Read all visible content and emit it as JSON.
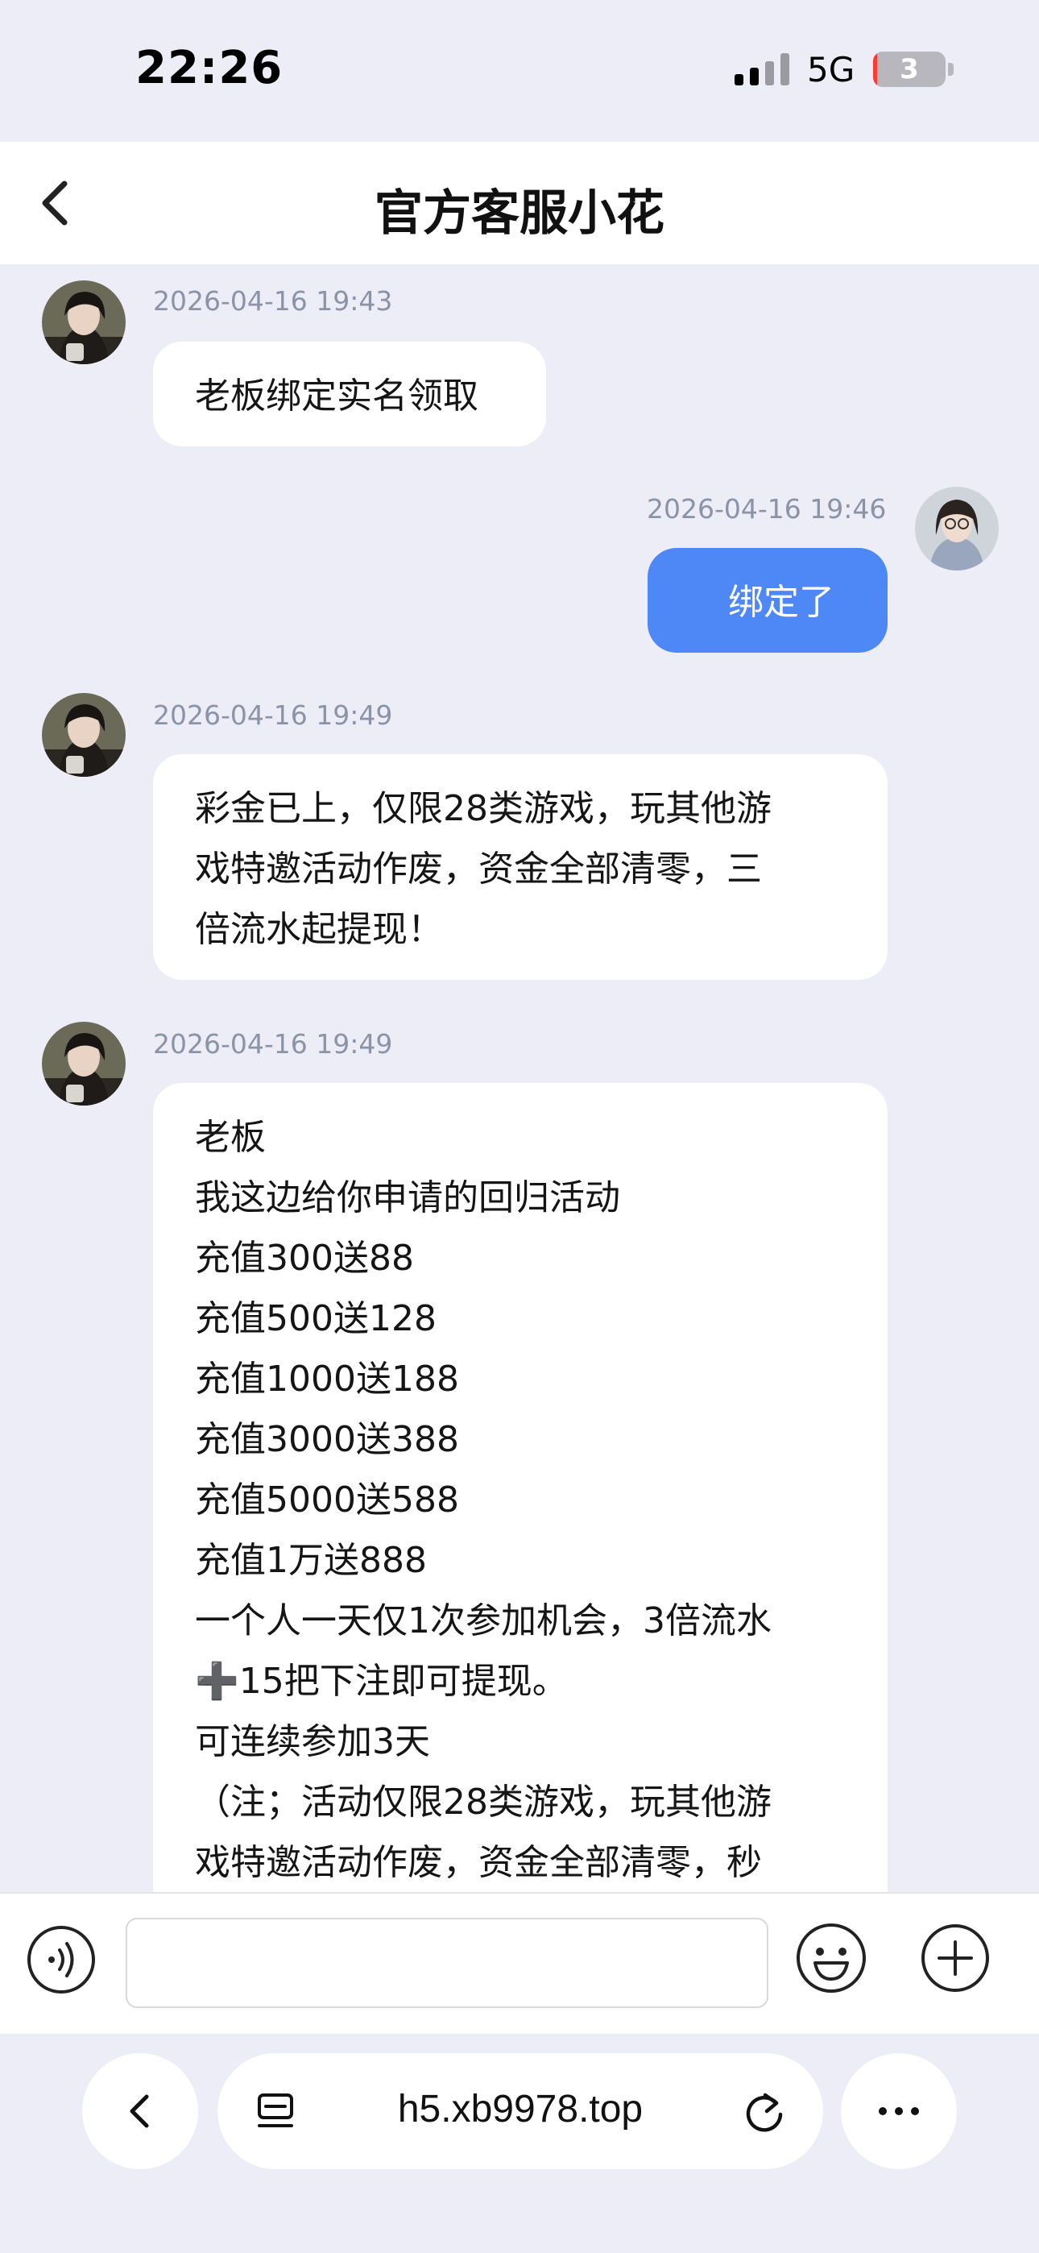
{
  "status_bar": {
    "time": "22:26",
    "network": "5G",
    "battery": "3",
    "battery_level": 0.03
  },
  "header": {
    "title": "官方客服小花",
    "back_icon": "chevron-left-icon"
  },
  "messages": [
    {
      "sender": "agent",
      "timestamp": "2026-04-16 19:43",
      "lines": [
        "老板绑定实名领取"
      ]
    },
    {
      "sender": "user",
      "timestamp": "2026-04-16 19:46",
      "lines": [
        "绑定了"
      ]
    },
    {
      "sender": "agent",
      "timestamp": "2026-04-16 19:49",
      "lines": [
        "彩金已上，仅限28类游戏，玩其他游",
        "戏特邀活动作废，资金全部清零，三",
        "倍流水起提现！"
      ]
    },
    {
      "sender": "agent",
      "timestamp": "2026-04-16 19:49",
      "lines": [
        "老板",
        "我这边给你申请的回归活动",
        "充值300送88",
        "充值500送128",
        "充值1000送188",
        "充值3000送388",
        "充值5000送588",
        "充值1万送888",
        "一个人一天仅1次参加机会，3倍流水",
        "➕15把下注即可提现。",
        "可连续参加3天",
        "（注；活动仅限28类游戏，玩其他游",
        "戏特邀活动作废，资金全部清零，秒"
      ]
    }
  ],
  "input_bar": {
    "placeholder": "",
    "voice_icon": "voice-icon",
    "emoji_icon": "emoji-icon",
    "plus_icon": "plus-circle-icon"
  },
  "browser": {
    "url": "h5.xb9978.top",
    "back_icon": "chevron-left-icon",
    "tabs_icon": "tabs-icon",
    "reload_icon": "reload-icon",
    "more_icon": "more-dots-icon"
  },
  "colors": {
    "background": "#ecedf6",
    "user_bubble": "#4e87f6",
    "agent_bubble": "#ffffff",
    "timestamp": "#8b93a6"
  }
}
